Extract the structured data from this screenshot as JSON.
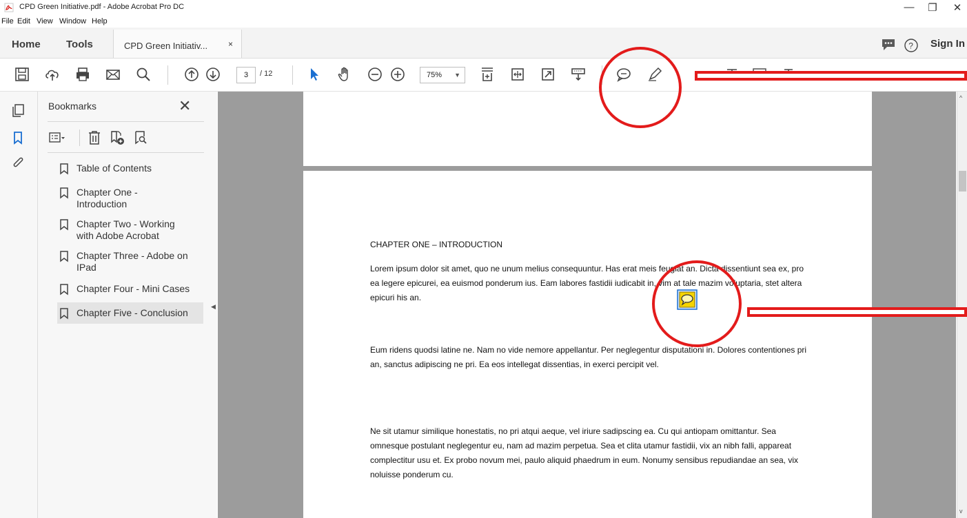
{
  "window": {
    "title": "CPD Green Initiative.pdf - Adobe Acrobat Pro DC",
    "minimize": "—",
    "restore": "❐",
    "close": "✕"
  },
  "menu": [
    "File",
    "Edit",
    "View",
    "Window",
    "Help"
  ],
  "tabs": {
    "home": "Home",
    "tools": "Tools",
    "document": "CPD Green Initiativ...",
    "document_close": "×",
    "sign_in": "Sign In"
  },
  "toolbar": {
    "page_current": "3",
    "page_total": "/ 12",
    "zoom": "75%",
    "zoom_arrow": "▼"
  },
  "bookmarks": {
    "title": "Bookmarks",
    "close": "✕",
    "items": [
      {
        "label": "Table of Contents"
      },
      {
        "label": "Chapter One - Introduction"
      },
      {
        "label": "Chapter Two - Working with Adobe Acrobat"
      },
      {
        "label": "Chapter Three - Adobe on IPad"
      },
      {
        "label": "Chapter Four - Mini Cases"
      },
      {
        "label": "Chapter Five - Conclusion",
        "selected": true
      }
    ]
  },
  "document": {
    "heading": "CHAPTER ONE – INTRODUCTION",
    "paragraphs": [
      "Lorem ipsum dolor sit amet, quo ne unum melius consequuntur. Has erat meis feugiat an. Dicta dissentiunt sea ex, pro ea legere epicurei, ea euismod ponderum ius. Eam labores fastidii iudicabit in, vim at tale mazim voluptaria, stet altera epicuri his an.",
      "Eum ridens quodsi latine ne. Nam no vide nemore appellantur. Per neglegentur disputationi in. Dolores contentiones pri an, sanctus adipiscing ne pri. Ea eos intellegat dissentias, in exerci percipit vel.",
      "Ne sit utamur similique honestatis, no pri atqui aeque, vel iriure sadipscing ea. Cu qui antiopam omittantur. Sea omnesque postulant neglegentur eu, nam ad mazim perpetua. Sea et clita utamur fastidii, vix an nibh falli, appareat complectitur usu et. Ex probo novum mei, paulo aliquid phaedrum in eum. Nonumy sensibus repudiandae an sea, vix noluisse ponderum cu."
    ]
  },
  "icons": {
    "scroll_up": "^",
    "scroll_down": "v",
    "splitter": "◀"
  },
  "colors": {
    "annotation_red": "#e31b1b",
    "accent_blue": "#1a6fd1",
    "note_yellow": "#f5d400"
  }
}
